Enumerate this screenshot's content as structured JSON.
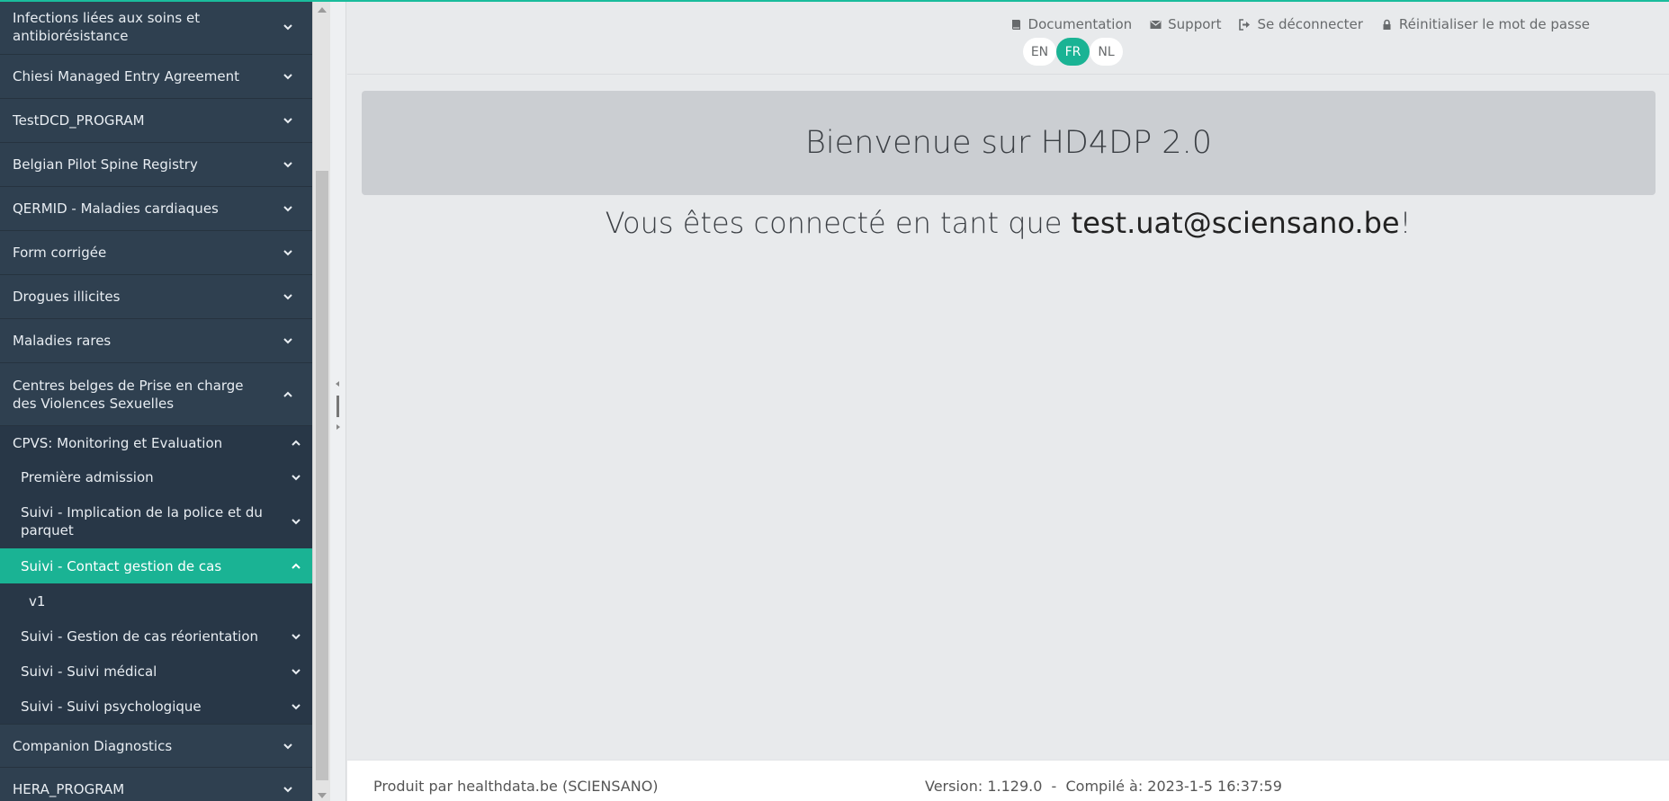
{
  "header": {
    "links": {
      "documentation": "Documentation",
      "support": "Support",
      "logout": "Se déconnecter",
      "reset_password": "Réinitialiser le mot de passe"
    },
    "languages": [
      "EN",
      "FR",
      "NL"
    ],
    "active_language": "FR"
  },
  "sidebar": {
    "items": [
      "Infections liées aux soins et antibiorésistance",
      "Chiesi Managed Entry Agreement",
      "TestDCD_PROGRAM",
      "Belgian Pilot Spine Registry",
      "QERMID - Maladies cardiaques",
      "Form corrigée",
      "Drogues illicites",
      "Maladies rares",
      "Centres belges de Prise en charge des Violences Sexuelles",
      "Companion Diagnostics",
      "HERA_PROGRAM"
    ],
    "sub_group": "CPVS: Monitoring et Evaluation",
    "sub_items": [
      "Première admission",
      "Suivi - Implication de la police et du parquet",
      "Suivi - Contact gestion de cas",
      "v1",
      "Suivi - Gestion de cas réorientation",
      "Suivi - Suivi médical",
      "Suivi - Suivi psychologique"
    ]
  },
  "main": {
    "welcome": "Bienvenue sur HD4DP 2.0",
    "connected_prefix": "Vous êtes connecté en tant que ",
    "connected_email": "test.uat@sciensano.be",
    "connected_suffix": "!"
  },
  "footer": {
    "produced_by": "Produit par healthdata.be (SCIENSANO)",
    "version": "Version: 1.129.0  -  Compilé à: 2023-1-5 16:37:59"
  },
  "colors": {
    "accent": "#1ab394",
    "sidebar": "#2f4050",
    "sidebar_sub": "#283747"
  }
}
